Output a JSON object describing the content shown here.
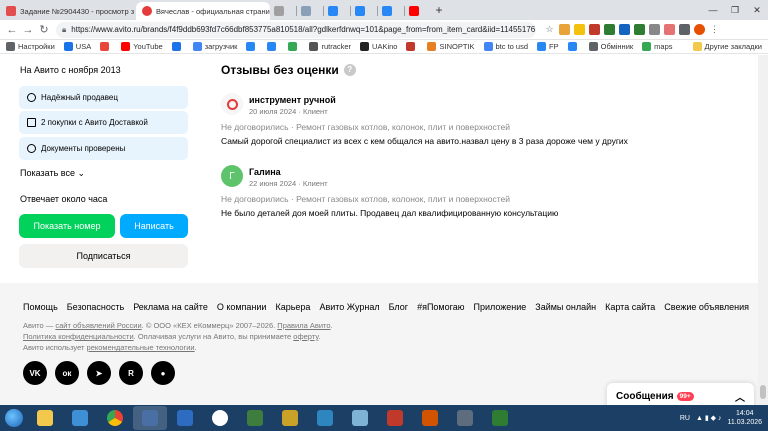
{
  "browser": {
    "tabs": [
      {
        "title": "Задание №2904430 - просмотр з",
        "active": false
      },
      {
        "title": "Вячеслав - официальная страни",
        "active": true
      },
      {
        "title": "",
        "active": false
      },
      {
        "title": "",
        "active": false
      },
      {
        "title": "",
        "active": false
      },
      {
        "title": "",
        "active": false
      },
      {
        "title": "",
        "active": false
      },
      {
        "title": "",
        "active": false
      }
    ],
    "url": "https://www.avito.ru/brands/f4f9ddb693fd7c66dbf853775a810518/all?gdlkerfdnwq=101&page_from=from_item_card&iid=11455176...",
    "bookmarks": [
      {
        "label": "Настройки",
        "color": "#5f6368"
      },
      {
        "label": "USA",
        "color": "#1a73e8"
      },
      {
        "label": "",
        "color": "#e8453c"
      },
      {
        "label": "YouTube",
        "color": "#ff0000"
      },
      {
        "label": "",
        "color": "#1a73e8"
      },
      {
        "label": "загрузчик",
        "color": "#4285f4"
      },
      {
        "label": "",
        "color": "#2787f5"
      },
      {
        "label": "",
        "color": "#2787f5"
      },
      {
        "label": "",
        "color": "#34a853"
      },
      {
        "label": "rutracker",
        "color": "#555555"
      },
      {
        "label": "UAKino",
        "color": "#222222"
      },
      {
        "label": "",
        "color": "#c0392b"
      },
      {
        "label": "SINOPTIK",
        "color": "#e67e22"
      },
      {
        "label": "btc to usd",
        "color": "#4285f4"
      },
      {
        "label": "FP",
        "color": "#2787f5"
      },
      {
        "label": "",
        "color": "#2787f5"
      },
      {
        "label": "Обмінник",
        "color": "#5f6368"
      },
      {
        "label": "maps",
        "color": "#34a853"
      }
    ],
    "other_bookmarks": "Другие закладки"
  },
  "seller": {
    "since": "На Авито с ноября 2013",
    "badges": [
      {
        "label": "Надёжный продавец",
        "icon": "check-circle-icon"
      },
      {
        "label": "2 покупки с Авито Доставкой",
        "icon": "cart-icon"
      },
      {
        "label": "Документы проверены",
        "icon": "check-circle-icon"
      }
    ],
    "show_all": "Показать все",
    "responds": "Отвечает около часа",
    "show_number": "Показать номер",
    "write": "Написать",
    "subscribe": "Подписаться"
  },
  "reviews": {
    "title": "Отзывы без оценки",
    "help": "?",
    "items": [
      {
        "name": "инструмент ручной",
        "avatar_letter": "",
        "meta": "20 июля 2024 · Клиент",
        "deal": "Не договорились · Ремонт газовых котлов, колонок, плит и поверхностей",
        "text": "Самый дорогой специалист из всех с кем общался на авито.назвал цену в 3 раза дороже чем у других"
      },
      {
        "name": "Галина",
        "avatar_letter": "Г",
        "meta": "22 июня 2024 · Клиент",
        "deal": "Не договорились · Ремонт газовых котлов, колонок, плит и поверхностей",
        "text": "Не было деталей доя моей плиты. Продавец дал квалифицированную консультацию"
      }
    ]
  },
  "footer": {
    "nav": [
      "Помощь",
      "Безопасность",
      "Реклама на сайте",
      "О компании",
      "Карьера",
      "Авито Журнал",
      "Блог",
      "#яПомогаю",
      "Приложение",
      "Займы онлайн",
      "Карта сайта",
      "Свежие объявления"
    ],
    "legal1_pre": "Авито — ",
    "legal1_link": "сайт объявлений России",
    "legal1_mid": ". © ООО «КЕХ еКоммерц» 2007–2026. ",
    "legal1_link2": "Правила Авито",
    "legal1_end": ".",
    "legal2_link": "Политика конфиденциальности",
    "legal2_mid": ". Оплачивая услуги на Авито, вы принимаете ",
    "legal2_link2": "оферту",
    "legal2_end": ".",
    "legal3_pre": "Авито использует ",
    "legal3_link": "рекомендательные технологии",
    "legal3_end": ".",
    "socials": [
      {
        "name": "vk-icon",
        "glyph": "VK"
      },
      {
        "name": "odnoklassniki-icon",
        "glyph": "ок"
      },
      {
        "name": "telegram-icon",
        "glyph": "➤"
      },
      {
        "name": "rutube-icon",
        "glyph": "R"
      },
      {
        "name": "dzen-icon",
        "glyph": "●"
      }
    ]
  },
  "messages": {
    "label": "Сообщения",
    "count": "99+",
    "chevron": "︿"
  },
  "taskbar": {
    "lang": "RU",
    "time": "14:04",
    "date": "11.03.2026"
  }
}
